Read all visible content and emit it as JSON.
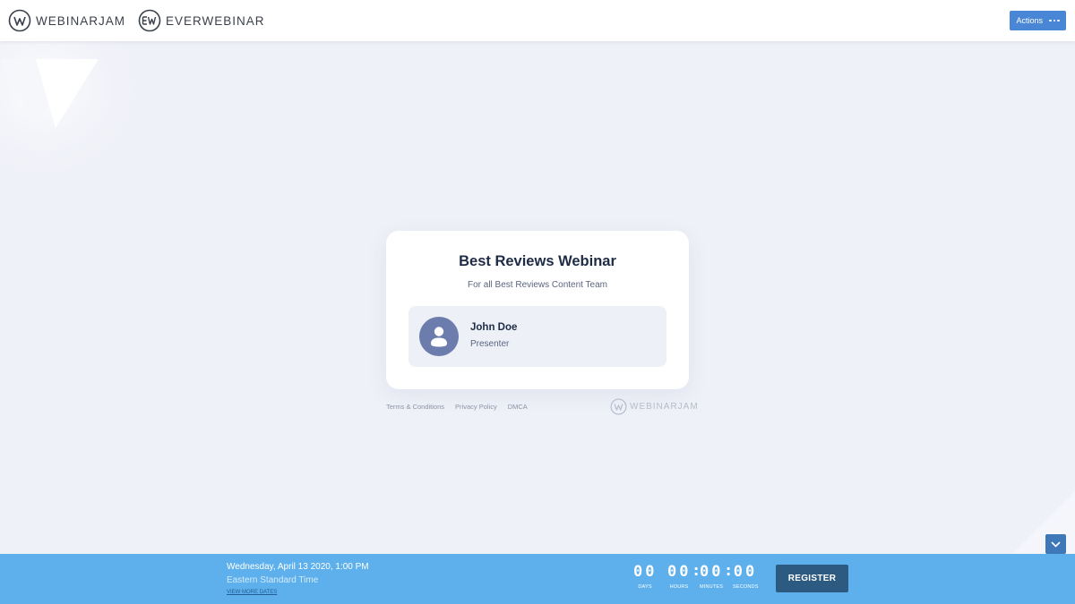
{
  "header": {
    "brand_primary": "WEBINARJAM",
    "brand_secondary": "EVERWEBINAR",
    "actions_label": "Actions"
  },
  "card": {
    "title": "Best Reviews Webinar",
    "subtitle": "For all Best Reviews Content Team",
    "presenter": {
      "name": "John Doe",
      "role": "Presenter"
    }
  },
  "footer": {
    "links": [
      "Terms & Conditions",
      "Privacy Policy",
      "DMCA"
    ],
    "brand": "WEBINARJAM"
  },
  "bottom_bar": {
    "date": "Wednesday, April 13 2020, 1:00 PM",
    "timezone": "Eastern Standard Time",
    "more_dates": "VIEW MORE DATES",
    "countdown": {
      "days": "00",
      "hours": "00",
      "minutes": "00",
      "seconds": "00",
      "days_label": "DAYS",
      "hours_label": "HOURS",
      "minutes_label": "MINUTES",
      "seconds_label": "SECONDS"
    },
    "register_label": "REGISTER"
  },
  "colors": {
    "background": "#eff1f8",
    "accent": "#4a86d6",
    "bar": "#5eb0ec",
    "register": "#2c5a80",
    "avatar": "#6b7cad"
  },
  "icons": [
    "webinarjam-logo-icon",
    "everwebinar-logo-icon",
    "more-dots-icon",
    "user-icon",
    "chevron-down-icon"
  ]
}
